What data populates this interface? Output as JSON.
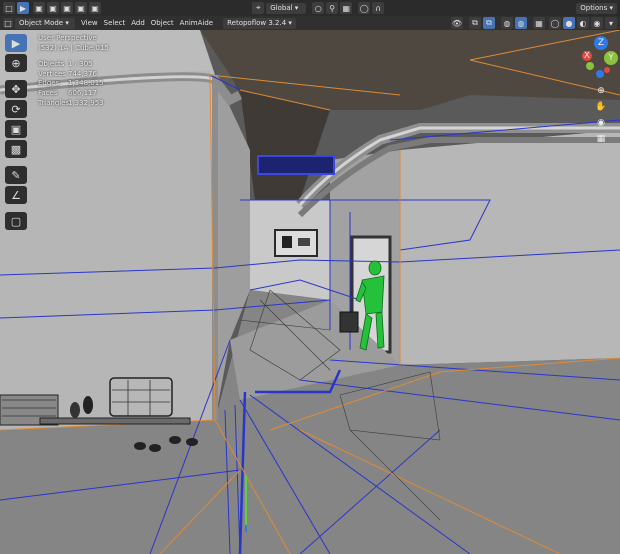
{
  "top_bar": {
    "editor_type": "▫",
    "transform_orientation": "Global",
    "options_label": "Options"
  },
  "header": {
    "mode": "Object Mode",
    "menus": [
      "View",
      "Select",
      "Add",
      "Object",
      "AnimAide"
    ],
    "addon": "Retopoflow 3.2.4"
  },
  "overlay_stats": {
    "view_name": "User Perspective",
    "collection": "(532) 1A | Cube.015",
    "rows": [
      {
        "key": "Objects",
        "value": "1 / 305"
      },
      {
        "key": "Vertices",
        "value": "744,376"
      },
      {
        "key": "Edges",
        "value": "1,348,015"
      },
      {
        "key": "Faces",
        "value": "606,117"
      },
      {
        "key": "Triangles",
        "value": "1,332,953"
      }
    ]
  },
  "tools": [
    "select-box",
    "cursor",
    "move",
    "rotate",
    "scale",
    "transform",
    "annotate",
    "measure",
    "add-cube"
  ],
  "gizmo_axes": {
    "z": "Z",
    "y": "Y",
    "x": "X"
  },
  "colors": {
    "accent": "#4772b3",
    "axis_x": "#e0493e",
    "axis_y": "#8ac23e",
    "axis_z": "#2f7be5",
    "wire": "#2a36c9",
    "selected_edge": "#e08a35",
    "figure": "#25c13a"
  }
}
